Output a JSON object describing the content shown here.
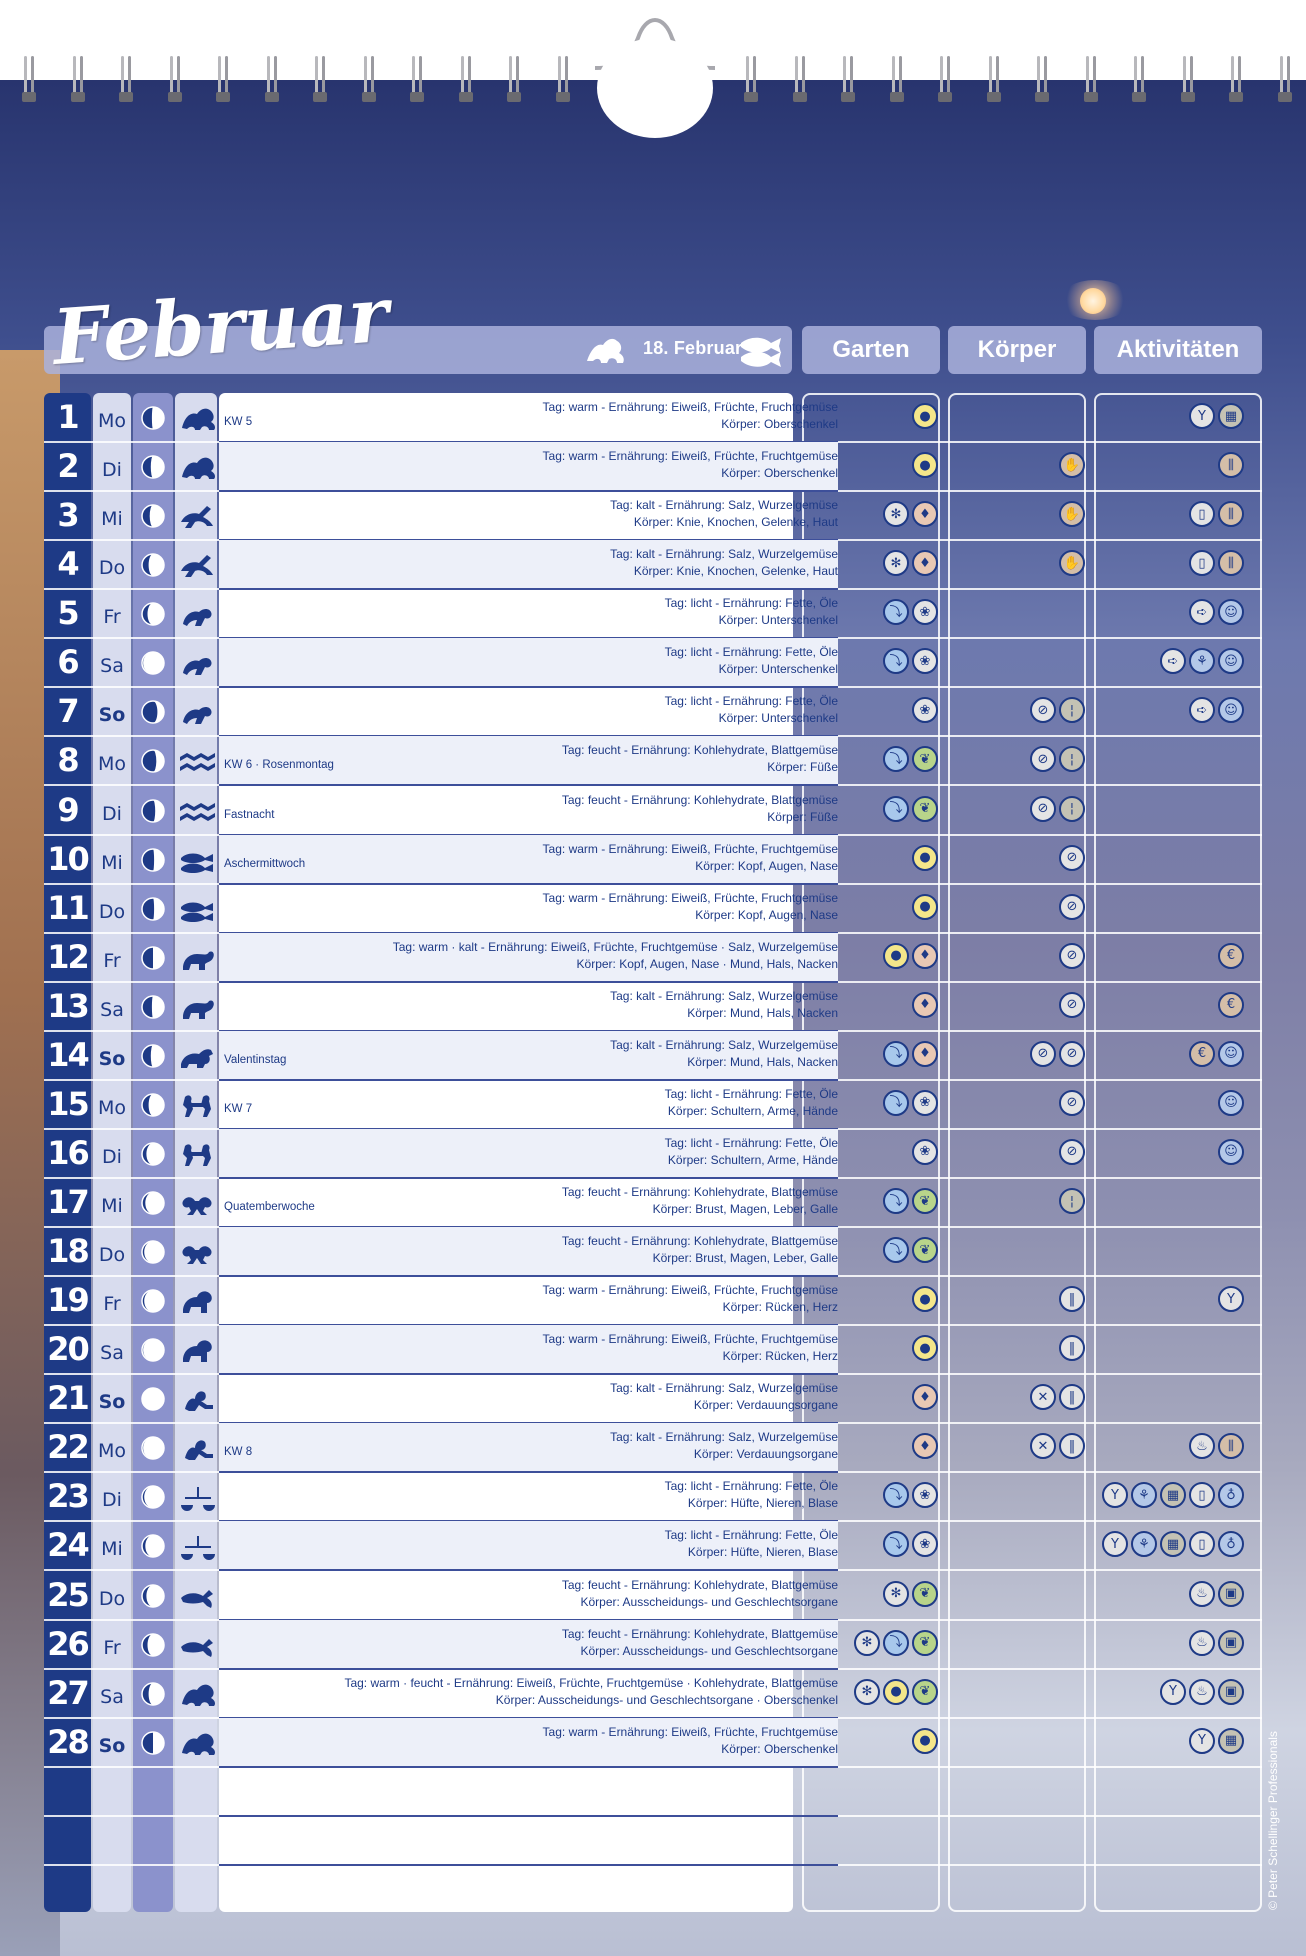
{
  "header": {
    "month": "Februar",
    "zodiac_date": "18. Februar",
    "zodiac_sign_from": "capricorn-icon",
    "zodiac_sign_to": "pisces-icon",
    "col_garten": "Garten",
    "col_koerper": "Körper",
    "col_aktivitaeten": "Aktivitäten"
  },
  "copyright": "© Peter Schellinger Professionals",
  "colors": {
    "navy": "#1e3a86",
    "strip_light": "#d8dcee",
    "strip_moon": "#8b92cc"
  },
  "days": [
    {
      "n": "1",
      "dow": "Mo",
      "moon": 0.55,
      "sign": "capricorn-icon",
      "note": "KW 5",
      "l1": "Tag: warm - Ernährung: Eiweiß, Früchte, Fruchtgemüse",
      "l2": "Körper: Oberschenkel",
      "g": [
        "fruit-icon"
      ],
      "k": [],
      "a": [
        "cocktail-icon",
        "window-icon"
      ]
    },
    {
      "n": "2",
      "dow": "Di",
      "moon": 0.6,
      "sign": "capricorn-icon",
      "note": "",
      "l1": "Tag: warm - Ernährung: Eiweiß, Früchte, Fruchtgemüse",
      "l2": "Körper: Oberschenkel",
      "g": [
        "fruit-icon"
      ],
      "k": [
        "hand-icon"
      ],
      "a": [
        "bottles-icon"
      ]
    },
    {
      "n": "3",
      "dow": "Mi",
      "moon": 0.65,
      "sign": "sagittarius-icon",
      "note": "",
      "l1": "Tag: kalt - Ernährung: Salz, Wurzelgemüse",
      "l2": "Körper: Knie, Knochen, Gelenke, Haut",
      "g": [
        "bug-icon",
        "root-icon"
      ],
      "k": [
        "hand-icon"
      ],
      "a": [
        "jar-icon",
        "bottles-icon"
      ]
    },
    {
      "n": "4",
      "dow": "Do",
      "moon": 0.7,
      "sign": "sagittarius-icon",
      "note": "",
      "l1": "Tag: kalt - Ernährung: Salz, Wurzelgemüse",
      "l2": "Körper: Knie, Knochen, Gelenke, Haut",
      "g": [
        "bug-icon",
        "root-icon"
      ],
      "k": [
        "hand-icon"
      ],
      "a": [
        "jar-icon",
        "bottles-icon"
      ]
    },
    {
      "n": "5",
      "dow": "Fr",
      "moon": 0.75,
      "sign": "scorpio-icon",
      "note": "",
      "l1": "Tag: licht - Ernährung: Fette, Öle",
      "l2": "Körper: Unterschenkel",
      "g": [
        "watering-icon",
        "flower-icon"
      ],
      "k": [],
      "a": [
        "arrow-icon",
        "face-icon"
      ]
    },
    {
      "n": "6",
      "dow": "Sa",
      "moon": 0.95,
      "sign": "scorpio-icon",
      "note": "",
      "l1": "Tag: licht - Ernährung: Fette, Öle",
      "l2": "Körper: Unterschenkel",
      "g": [
        "watering-icon",
        "flower-icon"
      ],
      "k": [],
      "a": [
        "arrow-icon",
        "paint-icon",
        "face-icon"
      ]
    },
    {
      "n": "7",
      "dow": "So",
      "moon": 0.3,
      "sign": "scorpio-icon",
      "note": "",
      "l1": "Tag: licht - Ernährung: Fette, Öle",
      "l2": "Körper: Unterschenkel",
      "g": [
        "flower-icon"
      ],
      "k": [
        "no-smoke-icon",
        "candle-icon"
      ],
      "a": [
        "arrow-icon",
        "face-icon"
      ]
    },
    {
      "n": "8",
      "dow": "Mo",
      "moon": 0.35,
      "sign": "aquarius-icon",
      "note": "KW 6 · Rosenmontag",
      "l1": "Tag: feucht - Ernährung: Kohlehydrate, Blattgemüse",
      "l2": "Körper: Füße",
      "g": [
        "watering-icon",
        "leaf-icon"
      ],
      "k": [
        "no-smoke-icon",
        "candle-icon"
      ],
      "a": []
    },
    {
      "n": "9",
      "dow": "Di",
      "moon": 0.4,
      "sign": "aquarius-icon",
      "note": "Fastnacht",
      "l1": "Tag: feucht - Ernährung: Kohlehydrate, Blattgemüse",
      "l2": "Körper: Füße",
      "g": [
        "watering-icon",
        "leaf-icon"
      ],
      "k": [
        "no-smoke-icon",
        "candle-icon"
      ],
      "a": []
    },
    {
      "n": "10",
      "dow": "Mi",
      "moon": 0.45,
      "sign": "pisces-icon",
      "note": "Aschermittwoch",
      "l1": "Tag: warm - Ernährung: Eiweiß, Früchte, Fruchtgemüse",
      "l2": "Körper: Kopf, Augen, Nase",
      "g": [
        "fruit-icon"
      ],
      "k": [
        "no-tool-icon"
      ],
      "a": []
    },
    {
      "n": "11",
      "dow": "Do",
      "moon": 0.45,
      "sign": "pisces-icon",
      "note": "",
      "l1": "Tag: warm - Ernährung: Eiweiß, Früchte, Fruchtgemüse",
      "l2": "Körper: Kopf, Augen, Nase",
      "g": [
        "fruit-icon"
      ],
      "k": [
        "no-tool-icon"
      ],
      "a": []
    },
    {
      "n": "12",
      "dow": "Fr",
      "moon": 0.5,
      "sign": "aries-icon",
      "note": "",
      "l1": "Tag: warm · kalt - Ernährung: Eiweiß, Früchte, Fruchtgemüse · Salz, Wurzelgemüse",
      "l2": "Körper: Kopf, Augen, Nase · Mund, Hals, Nacken",
      "g": [
        "fruit-icon",
        "root-icon"
      ],
      "k": [
        "no-tool-icon"
      ],
      "a": [
        "coin-icon"
      ]
    },
    {
      "n": "13",
      "dow": "Sa",
      "moon": 0.55,
      "sign": "aries-icon",
      "note": "",
      "l1": "Tag: kalt - Ernährung: Salz, Wurzelgemüse",
      "l2": "Körper: Mund, Hals, Nacken",
      "g": [
        "root-icon"
      ],
      "k": [
        "no-tool-icon"
      ],
      "a": [
        "coin-icon"
      ]
    },
    {
      "n": "14",
      "dow": "So",
      "moon": 0.6,
      "sign": "taurus-icon",
      "note": "Valentinstag",
      "l1": "Tag: kalt - Ernährung: Salz, Wurzelgemüse",
      "l2": "Körper: Mund, Hals, Nacken",
      "g": [
        "watering-icon",
        "root-icon"
      ],
      "k": [
        "no-tool-icon",
        "no-smoke-icon"
      ],
      "a": [
        "coin-icon",
        "face-icon"
      ]
    },
    {
      "n": "15",
      "dow": "Mo",
      "moon": 0.7,
      "sign": "gemini-icon",
      "note": "KW 7",
      "l1": "Tag: licht - Ernährung: Fette, Öle",
      "l2": "Körper: Schultern, Arme, Hände",
      "g": [
        "watering-icon",
        "flower-icon"
      ],
      "k": [
        "no-smoke-icon"
      ],
      "a": [
        "face-icon"
      ]
    },
    {
      "n": "16",
      "dow": "Di",
      "moon": 0.8,
      "sign": "gemini-icon",
      "note": "",
      "l1": "Tag: licht - Ernährung: Fette, Öle",
      "l2": "Körper: Schultern, Arme, Hände",
      "g": [
        "flower-icon"
      ],
      "k": [
        "no-smoke-icon"
      ],
      "a": [
        "face-icon"
      ]
    },
    {
      "n": "17",
      "dow": "Mi",
      "moon": 0.85,
      "sign": "cancer-icon",
      "note": "Quatemberwoche",
      "l1": "Tag: feucht - Ernährung: Kohlehydrate, Blattgemüse",
      "l2": "Körper: Brust, Magen, Leber, Galle",
      "g": [
        "watering-icon",
        "leaf-icon"
      ],
      "k": [
        "candle-icon"
      ],
      "a": []
    },
    {
      "n": "18",
      "dow": "Do",
      "moon": 0.9,
      "sign": "cancer-icon",
      "note": "",
      "l1": "Tag: feucht - Ernährung: Kohlehydrate, Blattgemüse",
      "l2": "Körper: Brust, Magen, Leber, Galle",
      "g": [
        "watering-icon",
        "leaf-icon"
      ],
      "k": [],
      "a": []
    },
    {
      "n": "19",
      "dow": "Fr",
      "moon": 0.9,
      "sign": "leo-icon",
      "note": "",
      "l1": "Tag: warm - Ernährung: Eiweiß, Früchte, Fruchtgemüse",
      "l2": "Körper: Rücken, Herz",
      "g": [
        "fruit-icon"
      ],
      "k": [
        "thermo-icon"
      ],
      "a": [
        "cocktail-icon"
      ]
    },
    {
      "n": "20",
      "dow": "Sa",
      "moon": 0.95,
      "sign": "leo-icon",
      "note": "",
      "l1": "Tag: warm - Ernährung: Eiweiß, Früchte, Fruchtgemüse",
      "l2": "Körper: Rücken, Herz",
      "g": [
        "fruit-icon"
      ],
      "k": [
        "thermo-icon"
      ],
      "a": []
    },
    {
      "n": "21",
      "dow": "So",
      "moon": 1.0,
      "sign": "virgo-icon",
      "note": "",
      "l1": "Tag: kalt - Ernährung: Salz, Wurzelgemüse",
      "l2": "Körper: Verdauungsorgane",
      "g": [
        "root-icon"
      ],
      "k": [
        "no-cut-icon",
        "thermo-icon"
      ],
      "a": []
    },
    {
      "n": "22",
      "dow": "Mo",
      "moon": 0.95,
      "sign": "virgo-icon",
      "note": "KW 8",
      "l1": "Tag: kalt - Ernährung: Salz, Wurzelgemüse",
      "l2": "Körper: Verdauungsorgane",
      "g": [
        "root-icon"
      ],
      "k": [
        "no-cut-icon",
        "thermo-icon"
      ],
      "a": [
        "wash-icon",
        "bottles-icon"
      ]
    },
    {
      "n": "23",
      "dow": "Di",
      "moon": 0.9,
      "sign": "libra-icon",
      "note": "",
      "l1": "Tag: licht - Ernährung: Fette, Öle",
      "l2": "Körper: Hüfte, Nieren, Blase",
      "g": [
        "watering-icon",
        "flower-icon"
      ],
      "k": [],
      "a": [
        "cocktail-icon",
        "paint-icon",
        "window-icon",
        "jar-icon",
        "drop-icon"
      ]
    },
    {
      "n": "24",
      "dow": "Mi",
      "moon": 0.85,
      "sign": "libra-icon",
      "note": "",
      "l1": "Tag: licht - Ernährung: Fette, Öle",
      "l2": "Körper: Hüfte, Nieren, Blase",
      "g": [
        "watering-icon",
        "flower-icon"
      ],
      "k": [],
      "a": [
        "cocktail-icon",
        "paint-icon",
        "window-icon",
        "jar-icon",
        "drop-icon"
      ]
    },
    {
      "n": "25",
      "dow": "Do",
      "moon": 0.8,
      "sign": "scorpio2-icon",
      "note": "",
      "l1": "Tag: feucht - Ernährung: Kohlehydrate, Blattgemüse",
      "l2": "Körper: Ausscheidungs- und Geschlechtsorgane",
      "g": [
        "bug-icon",
        "leaf-icon"
      ],
      "k": [],
      "a": [
        "wash-icon",
        "bucket-icon"
      ]
    },
    {
      "n": "26",
      "dow": "Fr",
      "moon": 0.75,
      "sign": "scorpio2-icon",
      "note": "",
      "l1": "Tag: feucht - Ernährung: Kohlehydrate, Blattgemüse",
      "l2": "Körper: Ausscheidungs- und Geschlechtsorgane",
      "g": [
        "bug-icon",
        "watering-icon",
        "leaf-icon"
      ],
      "k": [],
      "a": [
        "wash-icon",
        "bucket-icon"
      ]
    },
    {
      "n": "27",
      "dow": "Sa",
      "moon": 0.7,
      "sign": "capricorn-icon",
      "note": "",
      "l1": "Tag: warm · feucht - Ernährung: Eiweiß, Früchte, Fruchtgemüse · Kohlehydrate, Blattgemüse",
      "l2": "Körper: Ausscheidungs- und Geschlechtsorgane · Oberschenkel",
      "g": [
        "bug-icon",
        "fruit-icon",
        "leaf-icon"
      ],
      "k": [],
      "a": [
        "cocktail-icon",
        "wash-icon",
        "bucket-icon"
      ]
    },
    {
      "n": "28",
      "dow": "So",
      "moon": 0.5,
      "sign": "capricorn-icon",
      "note": "",
      "l1": "Tag: warm - Ernährung: Eiweiß, Früchte, Fruchtgemüse",
      "l2": "Körper: Oberschenkel",
      "g": [
        "fruit-icon"
      ],
      "k": [],
      "a": [
        "cocktail-icon",
        "window-icon"
      ]
    }
  ]
}
